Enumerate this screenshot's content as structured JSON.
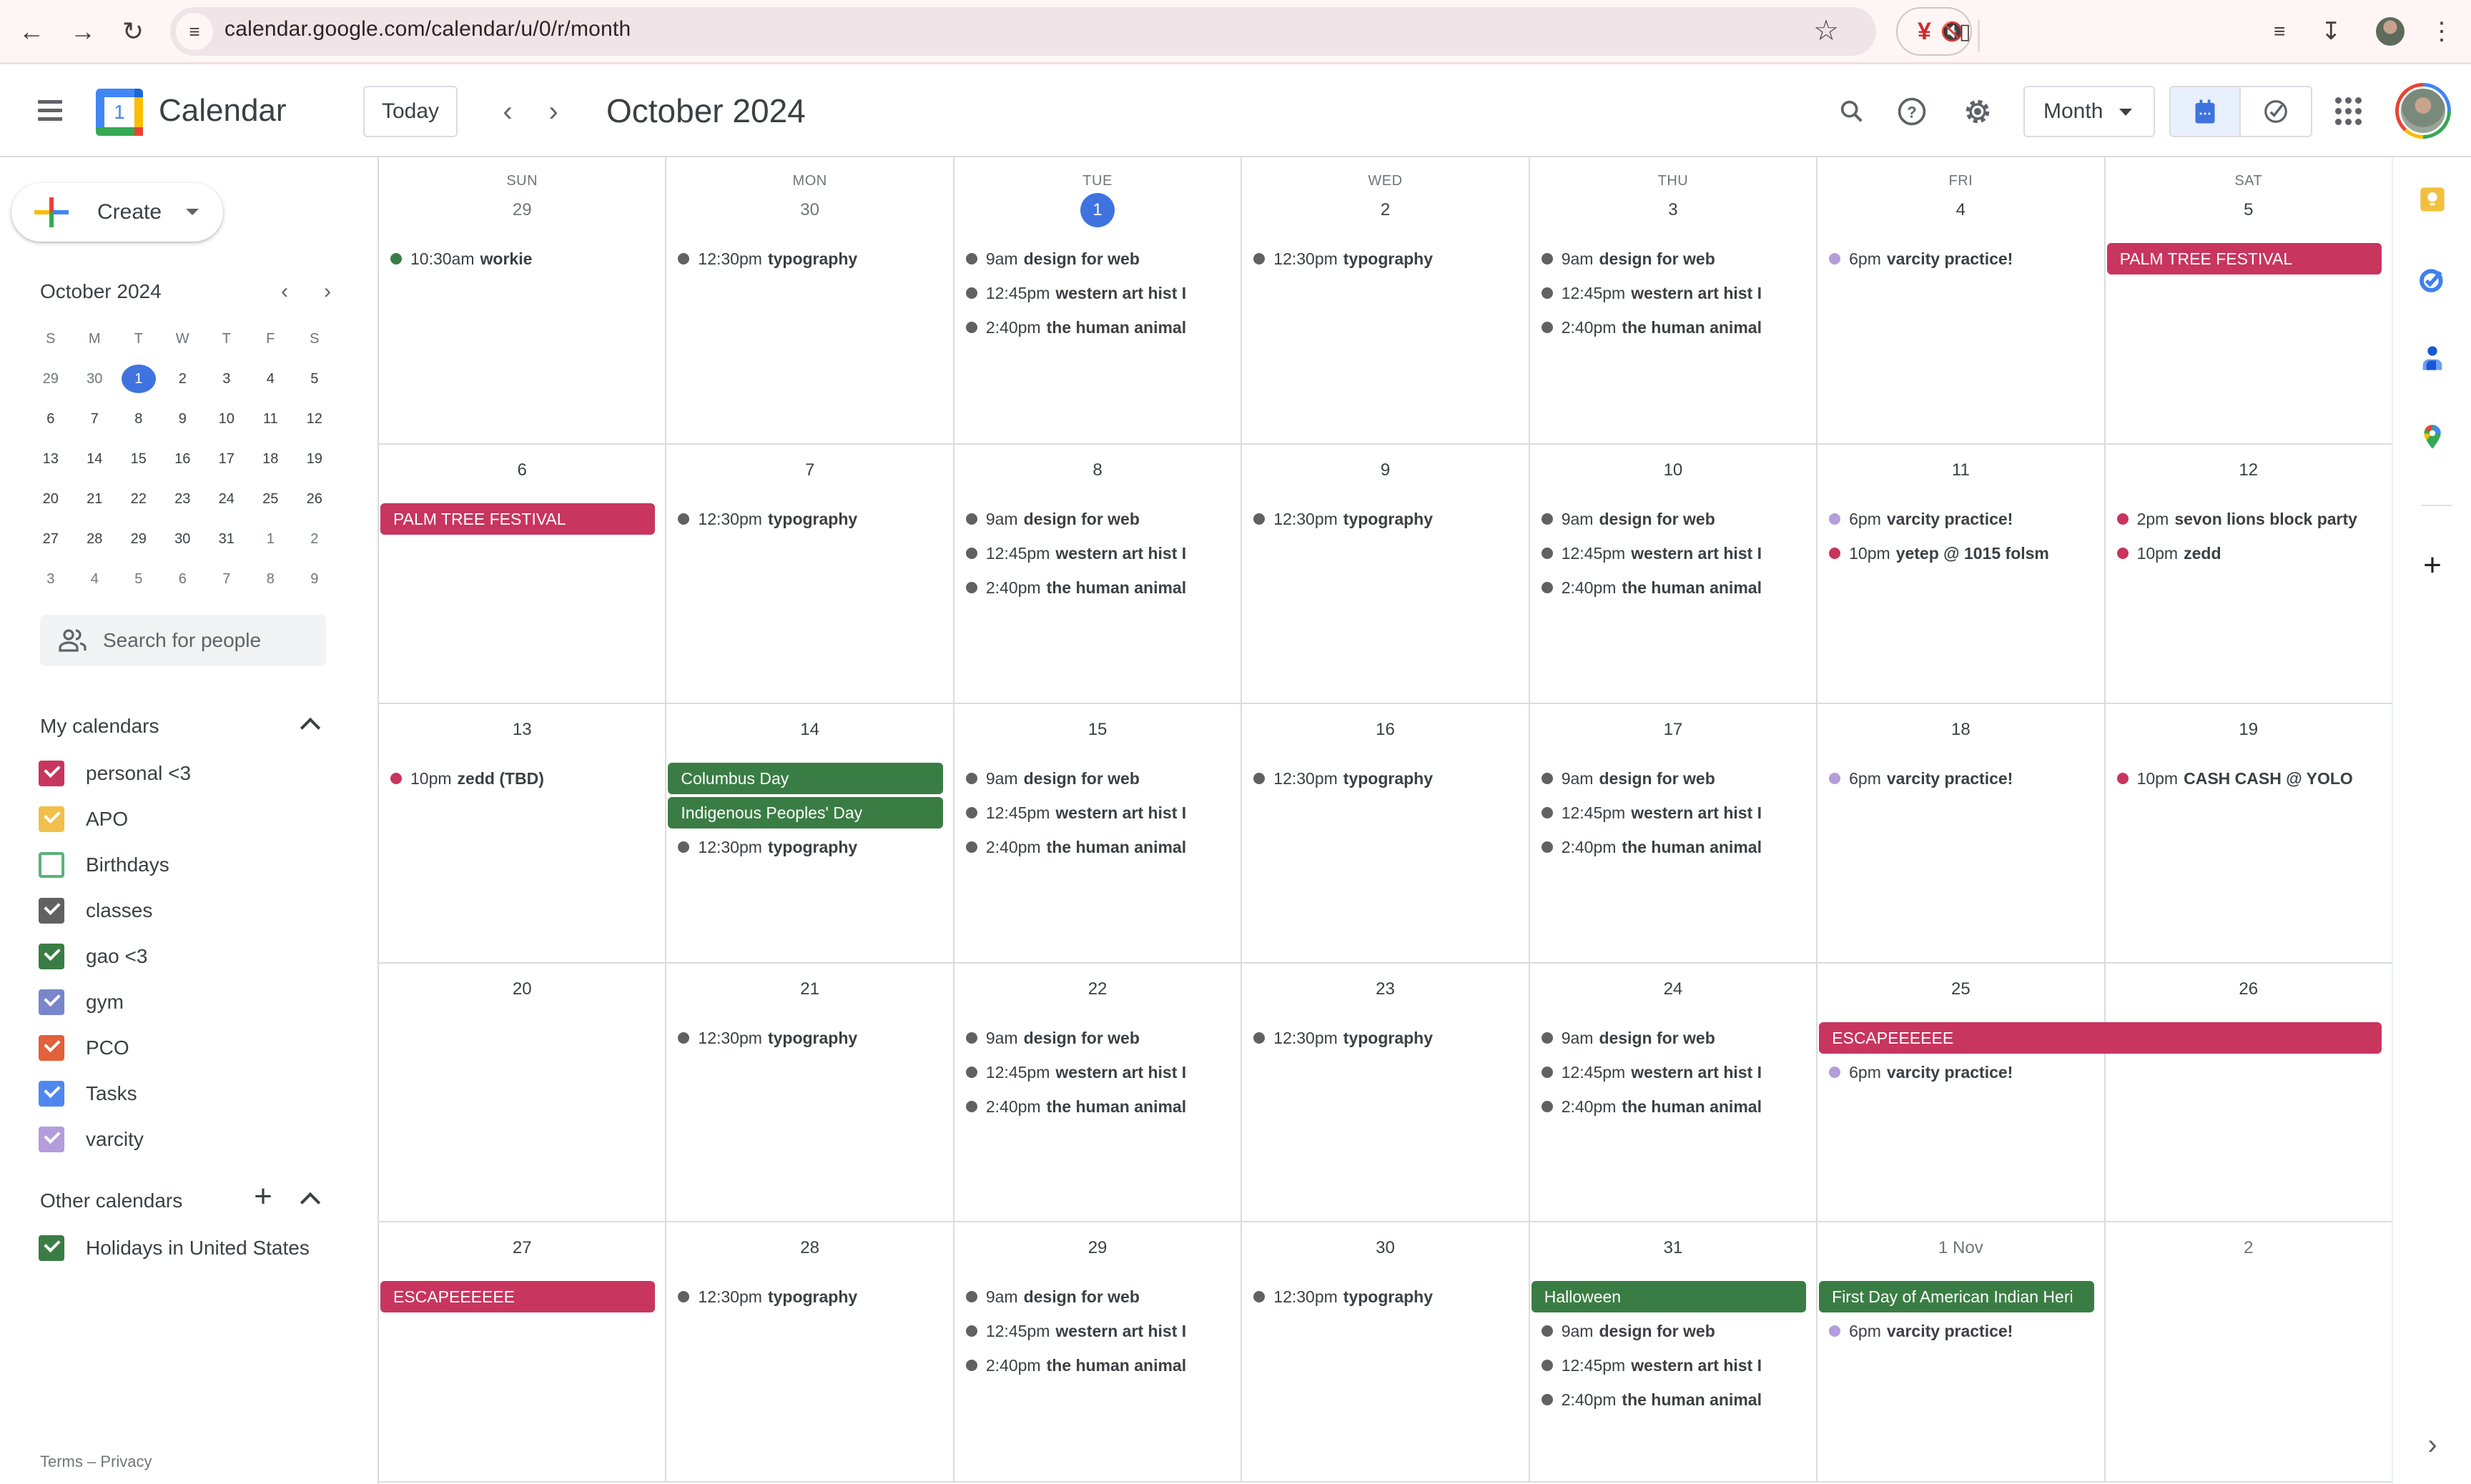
{
  "browser": {
    "url": "calendar.google.com/calendar/u/0/r/month",
    "icons": [
      "back-icon",
      "forward-icon",
      "reload-icon",
      "site-settings-icon",
      "bookmark-star-icon",
      "extension-icon",
      "mute-icon",
      "puzzle-extensions-icon",
      "media-controls-icon",
      "download-icon",
      "profile-avatar",
      "more-menu-icon"
    ]
  },
  "header": {
    "app_name": "Calendar",
    "logo_day": "1",
    "today_label": "Today",
    "title": "October 2024",
    "view_selector": "Month",
    "icons": [
      "menu-icon",
      "search-icon",
      "help-icon",
      "settings-icon",
      "calendar-view-icon",
      "tasks-view-icon",
      "google-apps-icon",
      "account-avatar"
    ]
  },
  "sidebar": {
    "create_label": "Create",
    "mini_calendar": {
      "title": "October 2024",
      "weekdays": [
        "S",
        "M",
        "T",
        "W",
        "T",
        "F",
        "S"
      ],
      "today": "1",
      "days": [
        {
          "d": "29",
          "out": true
        },
        {
          "d": "30",
          "out": true
        },
        {
          "d": "1",
          "today": true
        },
        {
          "d": "2"
        },
        {
          "d": "3"
        },
        {
          "d": "4"
        },
        {
          "d": "5"
        },
        {
          "d": "6"
        },
        {
          "d": "7"
        },
        {
          "d": "8"
        },
        {
          "d": "9"
        },
        {
          "d": "10"
        },
        {
          "d": "11"
        },
        {
          "d": "12"
        },
        {
          "d": "13"
        },
        {
          "d": "14"
        },
        {
          "d": "15"
        },
        {
          "d": "16"
        },
        {
          "d": "17"
        },
        {
          "d": "18"
        },
        {
          "d": "19"
        },
        {
          "d": "20"
        },
        {
          "d": "21"
        },
        {
          "d": "22"
        },
        {
          "d": "23"
        },
        {
          "d": "24"
        },
        {
          "d": "25"
        },
        {
          "d": "26"
        },
        {
          "d": "27"
        },
        {
          "d": "28"
        },
        {
          "d": "29"
        },
        {
          "d": "30"
        },
        {
          "d": "31"
        },
        {
          "d": "1",
          "out": true
        },
        {
          "d": "2",
          "out": true
        },
        {
          "d": "3",
          "out": true
        },
        {
          "d": "4",
          "out": true
        },
        {
          "d": "5",
          "out": true
        },
        {
          "d": "6",
          "out": true
        },
        {
          "d": "7",
          "out": true
        },
        {
          "d": "8",
          "out": true
        },
        {
          "d": "9",
          "out": true
        }
      ]
    },
    "search_people_placeholder": "Search for people",
    "my_calendars_title": "My calendars",
    "my_calendars": [
      {
        "name": "personal <3",
        "color": "#c8355f",
        "checked": true
      },
      {
        "name": "APO",
        "color": "#f0c04a",
        "checked": true
      },
      {
        "name": "Birthdays",
        "color": "#5ab27a",
        "checked": false
      },
      {
        "name": "classes",
        "color": "#616161",
        "checked": true
      },
      {
        "name": "gao <3",
        "color": "#3a7d44",
        "checked": true
      },
      {
        "name": "gym",
        "color": "#7986cb",
        "checked": true
      },
      {
        "name": "PCO",
        "color": "#e2603a",
        "checked": true
      },
      {
        "name": "Tasks",
        "color": "#4f87ee",
        "checked": true
      },
      {
        "name": "varcity",
        "color": "#b39ddb",
        "checked": true
      }
    ],
    "other_calendars_title": "Other calendars",
    "other_calendars": [
      {
        "name": "Holidays in United States",
        "color": "#3a7d44",
        "checked": true
      }
    ],
    "footer": "Terms – Privacy"
  },
  "colors": {
    "classes": "#616161",
    "personal": "#c8355f",
    "varcity": "#b39ddb",
    "gao": "#3a7d44",
    "holiday": "#3a7d44",
    "accent": "#3f74e0"
  },
  "month": {
    "weekdays": [
      "SUN",
      "MON",
      "TUE",
      "WED",
      "THU",
      "FRI",
      "SAT"
    ],
    "weeks": [
      {
        "days": [
          {
            "label": "29",
            "out": true,
            "events": [
              {
                "time": "10:30am",
                "title": "workie",
                "cal": "gao"
              }
            ]
          },
          {
            "label": "30",
            "out": true,
            "events": [
              {
                "time": "12:30pm",
                "title": "typography",
                "cal": "classes"
              }
            ]
          },
          {
            "label": "1",
            "today": true,
            "events": [
              {
                "time": "9am",
                "title": "design for web",
                "cal": "classes"
              },
              {
                "time": "12:45pm",
                "title": "western art hist I",
                "cal": "classes"
              },
              {
                "time": "2:40pm",
                "title": "the human animal",
                "cal": "classes"
              }
            ]
          },
          {
            "label": "2",
            "events": [
              {
                "time": "12:30pm",
                "title": "typography",
                "cal": "classes"
              }
            ]
          },
          {
            "label": "3",
            "events": [
              {
                "time": "9am",
                "title": "design for web",
                "cal": "classes"
              },
              {
                "time": "12:45pm",
                "title": "western art hist I",
                "cal": "classes"
              },
              {
                "time": "2:40pm",
                "title": "the human animal",
                "cal": "classes"
              }
            ]
          },
          {
            "label": "4",
            "events": [
              {
                "time": "6pm",
                "title": "varcity practice!",
                "cal": "varcity"
              }
            ]
          },
          {
            "label": "5",
            "events": []
          }
        ],
        "chips": [
          {
            "title": "PALM TREE FESTIVAL",
            "cal": "personal",
            "start": 6,
            "span": 1,
            "slot": 0
          }
        ]
      },
      {
        "days": [
          {
            "label": "6",
            "events": []
          },
          {
            "label": "7",
            "events": [
              {
                "time": "12:30pm",
                "title": "typography",
                "cal": "classes"
              }
            ]
          },
          {
            "label": "8",
            "events": [
              {
                "time": "9am",
                "title": "design for web",
                "cal": "classes"
              },
              {
                "time": "12:45pm",
                "title": "western art hist I",
                "cal": "classes"
              },
              {
                "time": "2:40pm",
                "title": "the human animal",
                "cal": "classes"
              }
            ]
          },
          {
            "label": "9",
            "events": [
              {
                "time": "12:30pm",
                "title": "typography",
                "cal": "classes"
              }
            ]
          },
          {
            "label": "10",
            "events": [
              {
                "time": "9am",
                "title": "design for web",
                "cal": "classes"
              },
              {
                "time": "12:45pm",
                "title": "western art hist I",
                "cal": "classes"
              },
              {
                "time": "2:40pm",
                "title": "the human animal",
                "cal": "classes"
              }
            ]
          },
          {
            "label": "11",
            "events": [
              {
                "time": "6pm",
                "title": "varcity practice!",
                "cal": "varcity"
              },
              {
                "time": "10pm",
                "title": "yetep @ 1015 folsm",
                "cal": "personal"
              }
            ]
          },
          {
            "label": "12",
            "events": [
              {
                "time": "2pm",
                "title": "sevon lions block party",
                "cal": "personal"
              },
              {
                "time": "10pm",
                "title": "zedd",
                "cal": "personal"
              }
            ]
          }
        ],
        "chips": [
          {
            "title": "PALM TREE FESTIVAL",
            "cal": "personal",
            "start": 0,
            "span": 1,
            "slot": 0
          }
        ]
      },
      {
        "days": [
          {
            "label": "13",
            "events": [
              {
                "time": "10pm",
                "title": "zedd (TBD)",
                "cal": "personal"
              }
            ]
          },
          {
            "label": "14",
            "offset": 2,
            "events": [
              {
                "time": "12:30pm",
                "title": "typography",
                "cal": "classes"
              }
            ]
          },
          {
            "label": "15",
            "events": [
              {
                "time": "9am",
                "title": "design for web",
                "cal": "classes"
              },
              {
                "time": "12:45pm",
                "title": "western art hist I",
                "cal": "classes"
              },
              {
                "time": "2:40pm",
                "title": "the human animal",
                "cal": "classes"
              }
            ]
          },
          {
            "label": "16",
            "events": [
              {
                "time": "12:30pm",
                "title": "typography",
                "cal": "classes"
              }
            ]
          },
          {
            "label": "17",
            "events": [
              {
                "time": "9am",
                "title": "design for web",
                "cal": "classes"
              },
              {
                "time": "12:45pm",
                "title": "western art hist I",
                "cal": "classes"
              },
              {
                "time": "2:40pm",
                "title": "the human animal",
                "cal": "classes"
              }
            ]
          },
          {
            "label": "18",
            "events": [
              {
                "time": "6pm",
                "title": "varcity practice!",
                "cal": "varcity"
              }
            ]
          },
          {
            "label": "19",
            "events": [
              {
                "time": "10pm",
                "title": "CASH CASH @ YOLO",
                "cal": "personal"
              }
            ]
          }
        ],
        "chips": [
          {
            "title": "Columbus Day",
            "cal": "holiday",
            "start": 1,
            "span": 1,
            "slot": 0
          },
          {
            "title": "Indigenous Peoples' Day",
            "cal": "holiday",
            "start": 1,
            "span": 1,
            "slot": 1
          }
        ]
      },
      {
        "days": [
          {
            "label": "20",
            "events": []
          },
          {
            "label": "21",
            "events": [
              {
                "time": "12:30pm",
                "title": "typography",
                "cal": "classes"
              }
            ]
          },
          {
            "label": "22",
            "events": [
              {
                "time": "9am",
                "title": "design for web",
                "cal": "classes"
              },
              {
                "time": "12:45pm",
                "title": "western art hist I",
                "cal": "classes"
              },
              {
                "time": "2:40pm",
                "title": "the human animal",
                "cal": "classes"
              }
            ]
          },
          {
            "label": "23",
            "events": [
              {
                "time": "12:30pm",
                "title": "typography",
                "cal": "classes"
              }
            ]
          },
          {
            "label": "24",
            "events": [
              {
                "time": "9am",
                "title": "design for web",
                "cal": "classes"
              },
              {
                "time": "12:45pm",
                "title": "western art hist I",
                "cal": "classes"
              },
              {
                "time": "2:40pm",
                "title": "the human animal",
                "cal": "classes"
              }
            ]
          },
          {
            "label": "25",
            "offset": 1,
            "events": [
              {
                "time": "6pm",
                "title": "varcity practice!",
                "cal": "varcity"
              }
            ]
          },
          {
            "label": "26",
            "events": []
          }
        ],
        "chips": [
          {
            "title": "ESCAPEEEEEE",
            "cal": "personal",
            "start": 5,
            "span": 2,
            "slot": 0
          }
        ]
      },
      {
        "days": [
          {
            "label": "27",
            "events": []
          },
          {
            "label": "28",
            "events": [
              {
                "time": "12:30pm",
                "title": "typography",
                "cal": "classes"
              }
            ]
          },
          {
            "label": "29",
            "events": [
              {
                "time": "9am",
                "title": "design for web",
                "cal": "classes"
              },
              {
                "time": "12:45pm",
                "title": "western art hist I",
                "cal": "classes"
              },
              {
                "time": "2:40pm",
                "title": "the human animal",
                "cal": "classes"
              }
            ]
          },
          {
            "label": "30",
            "events": [
              {
                "time": "12:30pm",
                "title": "typography",
                "cal": "classes"
              }
            ]
          },
          {
            "label": "31",
            "offset": 1,
            "events": [
              {
                "time": "9am",
                "title": "design for web",
                "cal": "classes"
              },
              {
                "time": "12:45pm",
                "title": "western art hist I",
                "cal": "classes"
              },
              {
                "time": "2:40pm",
                "title": "the human animal",
                "cal": "classes"
              }
            ]
          },
          {
            "label": "1 Nov",
            "out": true,
            "offset": 1,
            "events": [
              {
                "time": "6pm",
                "title": "varcity practice!",
                "cal": "varcity"
              }
            ]
          },
          {
            "label": "2",
            "out": true,
            "events": []
          }
        ],
        "chips": [
          {
            "title": "ESCAPEEEEEE",
            "cal": "personal",
            "start": 0,
            "span": 1,
            "slot": 0
          },
          {
            "title": "Halloween",
            "cal": "holiday",
            "start": 4,
            "span": 1,
            "slot": 0
          },
          {
            "title": "First Day of American Indian Heri",
            "cal": "holiday",
            "start": 5,
            "span": 1,
            "slot": 0
          }
        ]
      }
    ]
  },
  "right_rail": {
    "icons": [
      "keep-icon",
      "tasks-icon",
      "contacts-icon",
      "maps-icon",
      "add-addon-icon",
      "expand-panel-icon"
    ]
  }
}
